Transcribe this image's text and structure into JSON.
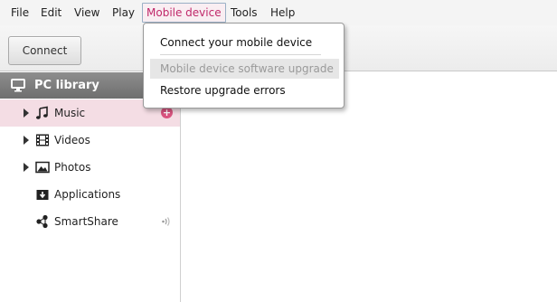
{
  "menubar": {
    "items": [
      {
        "label": "File"
      },
      {
        "label": "Edit"
      },
      {
        "label": "View"
      },
      {
        "label": "Play"
      },
      {
        "label": "Mobile device"
      },
      {
        "label": "Tools"
      },
      {
        "label": "Help"
      }
    ],
    "active_item": "Mobile device"
  },
  "toolbar": {
    "connect_label": "Connect"
  },
  "sidebar": {
    "header": {
      "label": "PC library",
      "icon": "monitor-icon"
    },
    "items": [
      {
        "label": "Music",
        "icon": "music-note-icon",
        "expandable": true,
        "selected": true,
        "badge": "+"
      },
      {
        "label": "Videos",
        "icon": "film-icon",
        "expandable": true
      },
      {
        "label": "Photos",
        "icon": "photo-icon",
        "expandable": true
      },
      {
        "label": "Applications",
        "icon": "download-box-icon",
        "expandable": false
      },
      {
        "label": "SmartShare",
        "icon": "share-network-icon",
        "expandable": false,
        "trailing_icon": "wireless-signal-icon"
      }
    ]
  },
  "dropdown": {
    "items": [
      {
        "label": "Connect your mobile device",
        "enabled": true
      },
      {
        "label": "Mobile device software upgrade",
        "enabled": false
      },
      {
        "label": "Restore upgrade errors",
        "enabled": true
      }
    ]
  },
  "colors": {
    "accent": "#c0286a",
    "selected_row": "#f4dde4",
    "header_bg": "#7e7e7e",
    "badge": "#d9537f"
  }
}
